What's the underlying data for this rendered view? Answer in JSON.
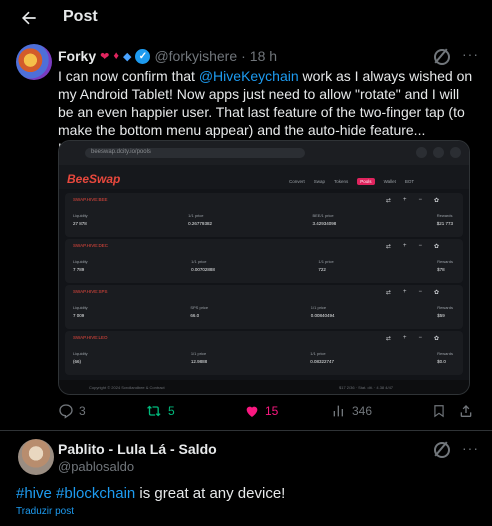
{
  "header": {
    "title": "Post",
    "back_icon": "arrow-left-icon"
  },
  "tweet": {
    "author_name": "Forky",
    "badges": [
      "❤",
      "♦",
      "◆"
    ],
    "handle": "@forkyishere",
    "separator": "·",
    "time": "18 h",
    "text_prefix": "I can now confirm that ",
    "mention": "@HiveKeychain",
    "text_suffix": " work as I always wished on my Android Tablet! Now apps just need to allow \"rotate\" and I will be an even happier user. That last feature of the two-finger tap (to make the bottom menu appear) and the auto-hide feature... Hummm hummm! Love it!",
    "media": {
      "url": "beeswap.dcity.io/pools",
      "logo_main": "BeeSwap",
      "logo_suffix": "",
      "nav": [
        "Convert",
        "Swap",
        "Tokens",
        "Pools",
        "",
        "Wallet",
        "BOT"
      ],
      "rows": [
        {
          "title": "SWAP.HIVE:BEE",
          "c1": "Liquidity",
          "v1": "27 878",
          "c2": "1/1 price",
          "v2": "0.26779382",
          "c3": "BEE/1 price",
          "v3": "3.42934098",
          "c4": "Rewards",
          "v4": "$21 773"
        },
        {
          "title": "SWAP.HIVE:DEC",
          "c1": "Liquidity",
          "v1": "7 789",
          "c2": "1/1 price",
          "v2": "0.00702888",
          "c3": "1/1 price",
          "v3": "722",
          "c4": "Rewards",
          "v4": "$78"
        },
        {
          "title": "SWAP.HIVE:SPS",
          "c1": "Liquidity",
          "v1": "7 009",
          "c2": "SPS price",
          "v2": "66.0",
          "c3": "1/1 price",
          "v3": "0.00840494",
          "c4": "Rewards",
          "v4": "$59"
        },
        {
          "title": "SWAP.HIVE:LEO",
          "c1": "Liquidity",
          "v1": "(66)",
          "c2": "1/1 price",
          "v2": "12.9888",
          "c3": "1/1 price",
          "v3": "0.08322747",
          "c4": "Rewards",
          "v4": "$0.0"
        }
      ],
      "footer_left": "Copyright © 2024 Scrollandbee & Contract",
      "footer_right": "$17 2/36  ·  Stat. dit.  ·  4.38 4/47"
    },
    "actions": {
      "reply_count": "3",
      "retweet_count": "5",
      "like_count": "15",
      "views_count": "346",
      "reply_icon": "reply-icon",
      "retweet_icon": "retweet-icon",
      "like_icon": "heart-icon",
      "views_icon": "views-icon",
      "bookmark_icon": "bookmark-icon",
      "share_icon": "share-icon"
    }
  },
  "reply": {
    "author_name": "Pablito - Lula Lá - Saldo",
    "handle": "@pablosaldo",
    "hashtag1": "#hive",
    "hashtag2": "#blockchain",
    "text": " is great at any device!",
    "translate_label": "Traduzir post"
  },
  "colors": {
    "background": "#000000",
    "text": "#e7e9ea",
    "muted": "#71767b",
    "link": "#1d9bf0",
    "retweet": "#00ba7c",
    "like": "#f91880",
    "beeswap_red": "#e8483d"
  }
}
